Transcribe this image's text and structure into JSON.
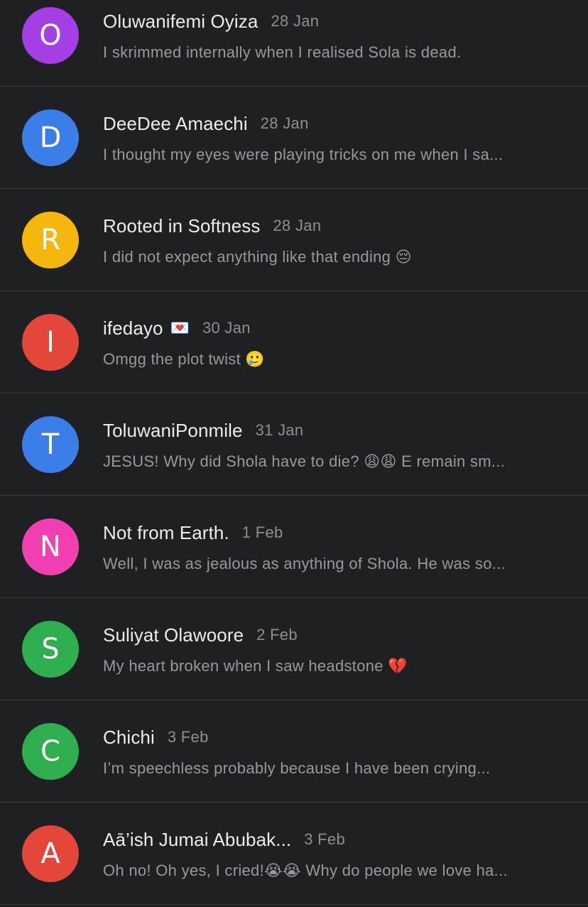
{
  "comments": [
    {
      "initial": "O",
      "color": "#a43fe6",
      "name": "Oluwanifemi Oyiza",
      "badge": "",
      "date": "28 Jan",
      "preview": "I skrimmed internally when I realised Sola is dead."
    },
    {
      "initial": "D",
      "color": "#3b7ee8",
      "name": "DeeDee Amaechi",
      "badge": "",
      "date": "28 Jan",
      "preview": "I thought my eyes were playing tricks on me when I sa..."
    },
    {
      "initial": "R",
      "color": "#f5b70d",
      "name": "Rooted in Softness",
      "badge": "",
      "date": "28 Jan",
      "preview": "I did not expect anything like that ending 😔"
    },
    {
      "initial": "I",
      "color": "#e4473a",
      "name": "ifedayo",
      "badge": "💌",
      "date": "30 Jan",
      "preview": "Omgg the plot twist 🥲"
    },
    {
      "initial": "T",
      "color": "#3b7ee8",
      "name": "ToluwaniPonmile",
      "badge": "",
      "date": "31 Jan",
      "preview": "JESUS! Why did Shola have to die? 😩😩 E remain sm..."
    },
    {
      "initial": "N",
      "color": "#f23fb2",
      "name": "Not from Earth.",
      "badge": "",
      "date": "1 Feb",
      "preview": "Well, I was as jealous as anything of Shola. He was so..."
    },
    {
      "initial": "S",
      "color": "#2fae4f",
      "name": "Suliyat Olawoore",
      "badge": "",
      "date": "2 Feb",
      "preview": "My heart broken when I saw headstone 💔"
    },
    {
      "initial": "C",
      "color": "#2fae4f",
      "name": "Chichi",
      "badge": "",
      "date": "3 Feb",
      "preview": "I’m speechless probably because I have been crying..."
    },
    {
      "initial": "A",
      "color": "#e4473a",
      "name": "Aā’ish Jumai Abubak...",
      "badge": "",
      "date": "3 Feb",
      "preview": "Oh no! Oh yes, I cried!😭😭 Why do people we love ha..."
    }
  ]
}
